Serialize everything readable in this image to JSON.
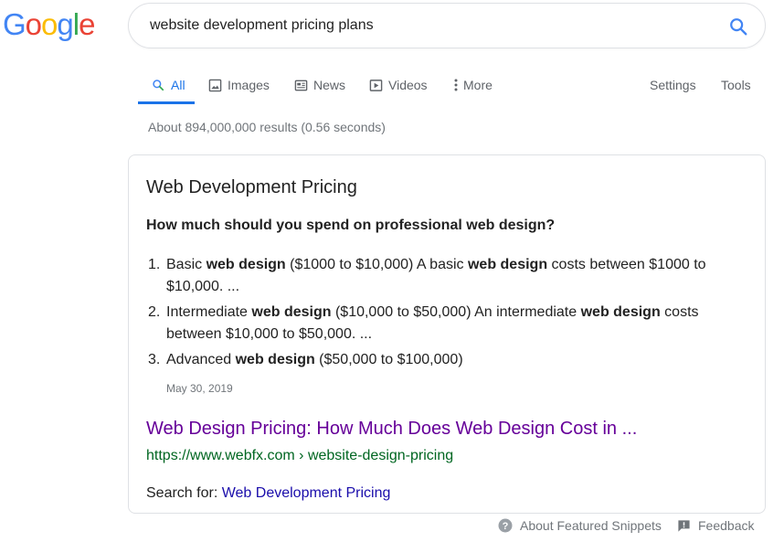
{
  "logo": {
    "letters": [
      "G",
      "o",
      "o",
      "g",
      "l",
      "e"
    ],
    "colors": [
      "#4285F4",
      "#EA4335",
      "#FBBC05",
      "#4285F4",
      "#34A853",
      "#EA4335"
    ]
  },
  "search": {
    "query": "website development pricing plans",
    "icon": "search-icon",
    "accent": "#4285F4"
  },
  "tabs": {
    "all": "All",
    "images": "Images",
    "news": "News",
    "videos": "Videos",
    "more": "More",
    "settings": "Settings",
    "tools": "Tools"
  },
  "stats": "About 894,000,000 results (0.56 seconds)",
  "snippet": {
    "title": "Web Development Pricing",
    "question_pre": "How much should you spend on professional ",
    "question_bold": "web design",
    "question_post": "?",
    "items": [
      {
        "num": "1.",
        "parts": [
          "Basic ",
          "web design",
          " ($1000 to $10,000) A basic ",
          "web design",
          " costs between $1000 to $10,000. ..."
        ]
      },
      {
        "num": "2.",
        "parts": [
          "Intermediate ",
          "web design",
          " ($10,000 to $50,000) An intermediate ",
          "web design",
          " costs between $10,000 to $50,000. ..."
        ]
      },
      {
        "num": "3.",
        "parts": [
          "Advanced ",
          "web design",
          " ($50,000 to $100,000)",
          "",
          ""
        ]
      }
    ],
    "date": "May 30, 2019",
    "result_title": "Web Design Pricing: How Much Does Web Design Cost in ...",
    "result_url": "https://www.webfx.com › website-design-pricing",
    "search_for_label": "Search for: ",
    "search_for_link": "Web Development Pricing"
  },
  "footer": {
    "about": "About Featured Snippets",
    "feedback": "Feedback"
  },
  "colors": {
    "link_visited": "#660099",
    "link": "#1a0dab",
    "url_green": "#006621",
    "tab_active": "#1a73e8",
    "muted": "#70757a"
  }
}
